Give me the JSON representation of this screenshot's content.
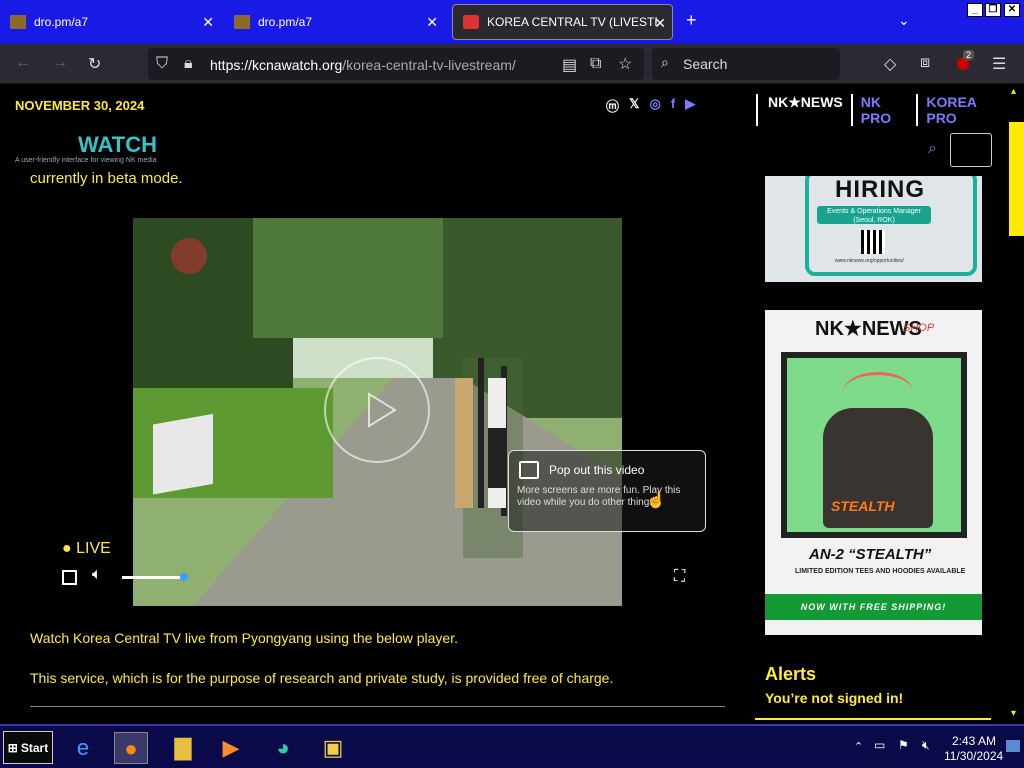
{
  "browser": {
    "tabs": [
      {
        "label": "dro.pm/a7"
      },
      {
        "label": "dro.pm/a7"
      },
      {
        "label": "KOREA CENTRAL TV (LIVESTRE"
      }
    ],
    "new_tab": "+",
    "url_host": "https://kcnawatch.org",
    "url_path": "/korea-central-tv-livestream/",
    "search_placeholder": "Search",
    "extension_badge": "2"
  },
  "site": {
    "date": "NOVEMBER 30, 2024",
    "nav": [
      "NK★NEWS",
      "NK PRO",
      "KOREA PRO"
    ],
    "logo": "WATCH",
    "logo_sub": "A user-friendly interface for viewing NK media",
    "beta_text": "currently in beta mode."
  },
  "player": {
    "live": "● LIVE",
    "popout_title": "Pop out this video",
    "popout_desc": "More screens are more fun. Play this video while you do other things."
  },
  "article": {
    "para1": "Watch Korea Central TV live from Pyongyang using the below player.",
    "para2": "This service, which is for the purpose of research and private study, is provided free of charge."
  },
  "sidebar": {
    "ad1_title": "HIRING",
    "ad1_pill": "Events & Operations Manager (Seoul, ROK)",
    "ad1_url": "www.nknews.org/opportunities/",
    "ad2_brand": "NK★NEWS",
    "ad2_shop": "SHOP",
    "ad2_stealth": "STEALTH",
    "ad2_name": "AN-2 “STEALTH”",
    "ad2_limited": "LIMITED EDITION TEES AND HOODIES AVAILABLE",
    "ad2_ship": "NOW WITH FREE SHIPPING!",
    "alerts_title": "Alerts",
    "signin": "You’re not signed in!"
  },
  "taskbar": {
    "start": "Start",
    "time": "2:43 AM",
    "date": "11/30/2024"
  }
}
